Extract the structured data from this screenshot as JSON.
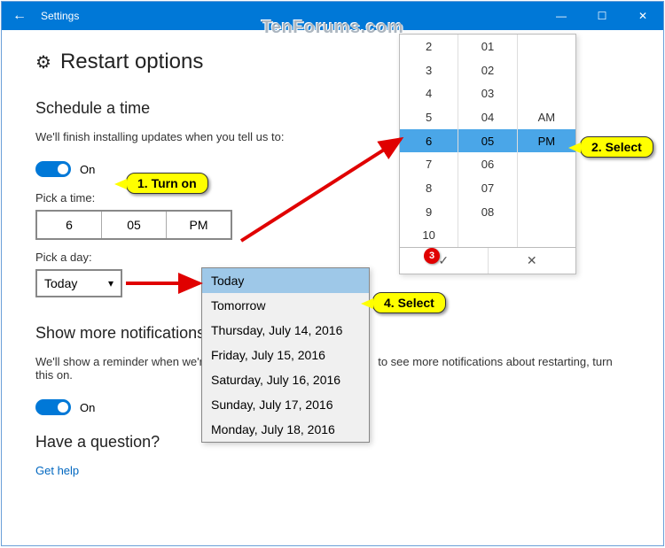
{
  "window": {
    "title": "Settings",
    "watermark": "TenForums.com"
  },
  "header": {
    "title": "Restart options"
  },
  "schedule": {
    "heading": "Schedule a time",
    "desc": "We'll finish installing updates when you tell us to:",
    "toggle_label": "On",
    "pick_time_label": "Pick a time:",
    "time": {
      "hour": "6",
      "minute": "05",
      "ampm": "PM"
    },
    "pick_day_label": "Pick a day:",
    "day_selected": "Today"
  },
  "time_picker": {
    "hours": [
      "2",
      "3",
      "4",
      "5",
      "6",
      "7",
      "8",
      "9",
      "10"
    ],
    "minutes": [
      "01",
      "02",
      "03",
      "04",
      "05",
      "06",
      "07",
      "08",
      ""
    ],
    "ampm": [
      "",
      "",
      "",
      "AM",
      "PM",
      "",
      "",
      "",
      ""
    ],
    "selected_index": 4,
    "accept": "✓",
    "cancel": "✕"
  },
  "day_dropdown": {
    "items": [
      "Today",
      "Tomorrow",
      "Thursday, July 14, 2016",
      "Friday, July 15, 2016",
      "Saturday, July 16, 2016",
      "Sunday, July 17, 2016",
      "Monday, July 18, 2016"
    ],
    "selected_index": 0
  },
  "callouts": {
    "c1": "1. Turn on",
    "c2": "2. Select",
    "c3": "3",
    "c4": "4. Select"
  },
  "more": {
    "heading": "Show more notifications",
    "desc_left": "We'll show a reminder when we'r",
    "desc_right": " to see more notifications about restarting, turn this on.",
    "toggle_label": "On"
  },
  "question": {
    "heading": "Have a question?",
    "link": "Get help"
  }
}
